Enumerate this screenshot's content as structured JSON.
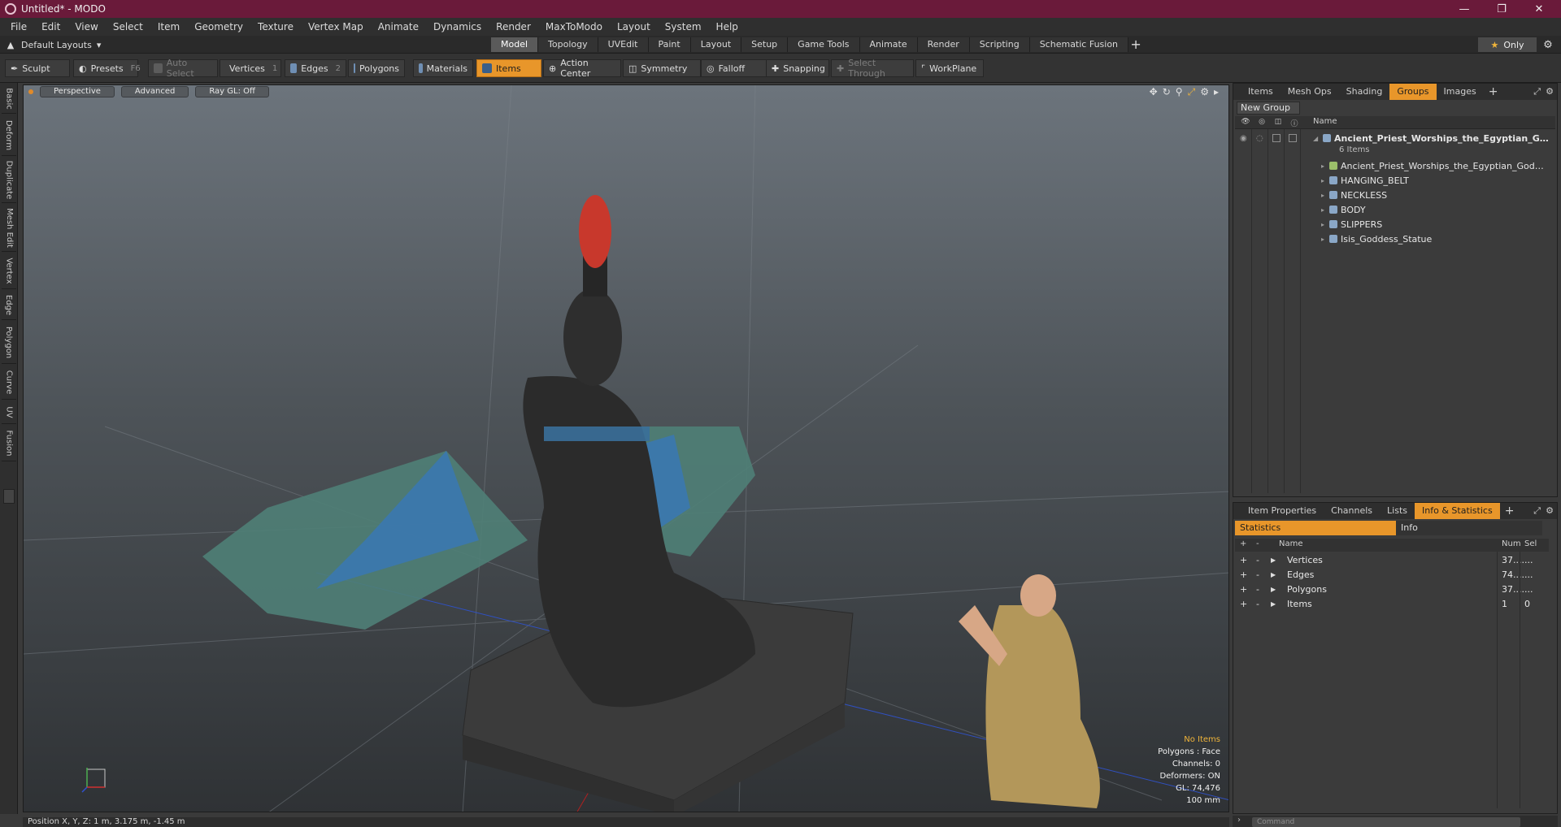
{
  "window": {
    "title": "Untitled* - MODO"
  },
  "menu": [
    "File",
    "Edit",
    "View",
    "Select",
    "Item",
    "Geometry",
    "Texture",
    "Vertex Map",
    "Animate",
    "Dynamics",
    "Render",
    "MaxToModo",
    "Layout",
    "System",
    "Help"
  ],
  "layout": {
    "layouts_label": "Default Layouts",
    "tabs": [
      "Model",
      "Topology",
      "UVEdit",
      "Paint",
      "Layout",
      "Setup",
      "Game Tools",
      "Animate",
      "Render",
      "Scripting",
      "Schematic Fusion"
    ],
    "active_tab": "Model",
    "only_label": "Only"
  },
  "toolbar": {
    "sculpt": "Sculpt",
    "presets": "Presets",
    "presets_key": "F6",
    "auto_select": "Auto Select",
    "vertices": "Vertices",
    "vertices_key": "1",
    "edges": "Edges",
    "edges_key": "2",
    "polygons": "Polygons",
    "materials": "Materials",
    "items": "Items",
    "action_center": "Action Center",
    "symmetry": "Symmetry",
    "falloff": "Falloff",
    "snapping": "Snapping",
    "select_through": "Select Through",
    "workplane": "WorkPlane"
  },
  "left_tabs": [
    "Basic",
    "Deform",
    "Duplicate",
    "Mesh Edit",
    "Vertex",
    "Edge",
    "Polygon",
    "Curve",
    "UV",
    "Fusion"
  ],
  "viewport": {
    "view_mode": "Perspective",
    "shading": "Advanced",
    "raygl": "Ray GL: Off",
    "stats": {
      "no_items": "No Items",
      "polygons": "Polygons : Face",
      "channels": "Channels: 0",
      "deformers": "Deformers: ON",
      "gl": "GL: 74,476",
      "scale": "100 mm"
    }
  },
  "status": {
    "position": "Position X, Y, Z:  1 m, 3.175 m, -1.45 m"
  },
  "groups_panel": {
    "tabs": [
      "Items",
      "Mesh Ops",
      "Shading",
      "Groups",
      "Images"
    ],
    "active_tab": "Groups",
    "new_group": "New Group",
    "column_name": "Name",
    "group": {
      "name": "Ancient_Priest_Worships_the_Egyptian_G ...",
      "count": "6 Items"
    },
    "items": [
      "Ancient_Priest_Worships_the_Egyptian_Goddes ...",
      "HANGING_BELT",
      "NECKLESS",
      "BODY",
      "SLIPPERS",
      "Isis_Goddess_Statue"
    ]
  },
  "info_panel": {
    "tabs": [
      "Item Properties",
      "Channels",
      "Lists",
      "Info & Statistics"
    ],
    "active_tab": "Info & Statistics",
    "subtabs": [
      "Statistics",
      "Info"
    ],
    "columns": {
      "plus": "+",
      "minus": "-",
      "name": "Name",
      "num": "Num",
      "sel": "Sel"
    },
    "rows": [
      {
        "name": "Vertices",
        "num": "37....",
        "sel": "..."
      },
      {
        "name": "Edges",
        "num": "74....",
        "sel": "..."
      },
      {
        "name": "Polygons",
        "num": "37....",
        "sel": "..."
      },
      {
        "name": "Items",
        "num": "1",
        "sel": "0"
      }
    ]
  },
  "command": {
    "placeholder": "Command"
  },
  "colors": {
    "title_bar": "#6a1a3a",
    "accent": "#e8962a",
    "highlight_text": "#f0b43a"
  }
}
